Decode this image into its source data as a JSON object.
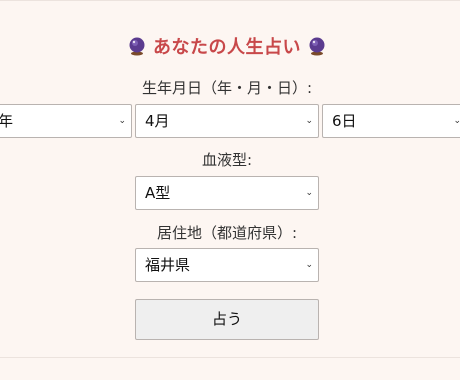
{
  "form": {
    "title": "あなたの人生占い",
    "title_icon": "crystal-ball-icon",
    "birthdate_label": "生年月日（年・月・日）:",
    "year_value": "年",
    "month_value": "4月",
    "day_value": "6日",
    "blood_label": "血液型:",
    "blood_value": "A型",
    "prefecture_label": "居住地（都道府県）:",
    "prefecture_value": "福井県",
    "submit_label": "占う"
  },
  "colors": {
    "background": "#fdf6f2",
    "title": "#c8484a"
  }
}
